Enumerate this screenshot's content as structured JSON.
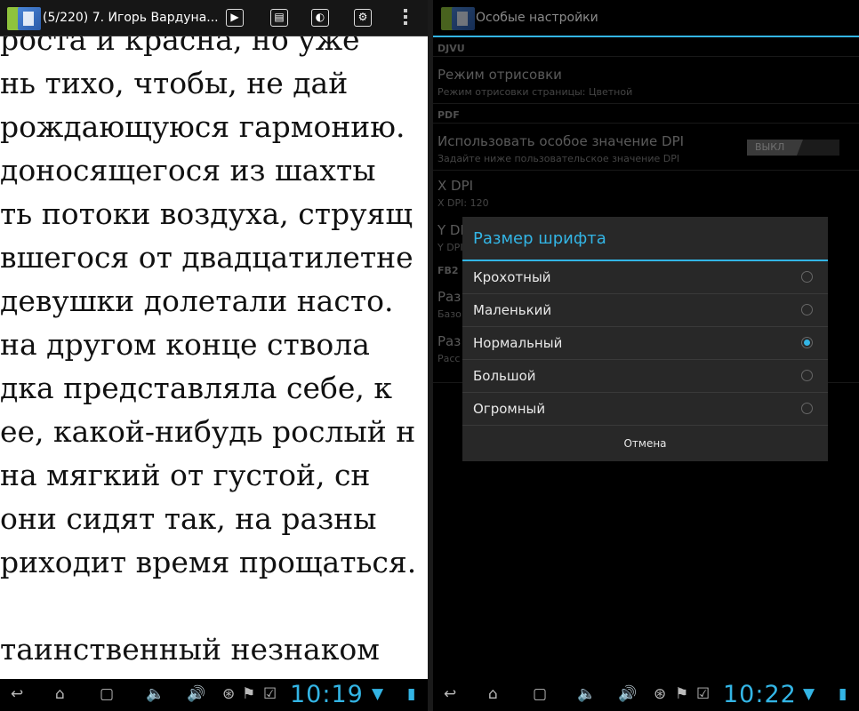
{
  "reader": {
    "title": "(5/220) 7. Игорь Вардуна...",
    "toolbar_icons": [
      "arrow-right-icon",
      "page-mode-icon",
      "brightness-icon",
      "settings-icon",
      "overflow-menu-icon"
    ],
    "lines": [
      "роста и красна,  но уже",
      "нь  тихо,  чтобы,  не  дай",
      "рождающуюся гармонию.",
      "доносящегося  из  шахты",
      "ть потоки воздуха, струящ",
      "вшегося от двадцатилетне",
      " девушки долетали насто.",
      "на  другом  конце  ствола",
      "дка  представляла  себе,  к",
      "ее, какой-нибудь рослый н",
      "на  мягкий  от  густой,  сн",
      "они сидят так, на разны",
      "риходит время прощаться.",
      "",
      " таинственный  незнаком",
      "..."
    ],
    "clock": "10:19"
  },
  "settings": {
    "title": "Особые настройки",
    "sections": {
      "djvu": "DJVU",
      "pdf": "PDF",
      "fb2": "FB2"
    },
    "render_mode": {
      "title": "Режим отрисовки",
      "summary": "Режим отрисовки страницы: Цветной"
    },
    "custom_dpi": {
      "title": "Использовать особое значение DPI",
      "summary": "Задайте ниже пользовательское значение DPI",
      "toggle": "ВЫКЛ"
    },
    "xdpi": {
      "title": "X DPI",
      "summary": "X DPI: 120"
    },
    "ydpi": {
      "title": "Y DPI",
      "summary": "Y DPI"
    },
    "fb2_size": {
      "title": "Раз",
      "summary": "Базо"
    },
    "fb2_spacing": {
      "title": "Раз",
      "summary": "Расс Дым"
    },
    "clock": "10:22"
  },
  "dialog": {
    "title": "Размер шрифта",
    "options": [
      {
        "label": "Крохотный",
        "selected": false
      },
      {
        "label": "Маленький",
        "selected": false
      },
      {
        "label": "Нормальный",
        "selected": true
      },
      {
        "label": "Большой",
        "selected": false
      },
      {
        "label": "Огромный",
        "selected": false
      }
    ],
    "cancel": "Отмена"
  },
  "navbar_icons": [
    "back-icon",
    "home-icon",
    "recent-apps-icon",
    "volume-down-icon",
    "volume-up-icon",
    "usb-icon",
    "android-debug-icon",
    "checklist-icon",
    "wifi-icon",
    "battery-icon"
  ],
  "colors": {
    "accent": "#33b5e5",
    "dialog_bg": "#282828"
  }
}
